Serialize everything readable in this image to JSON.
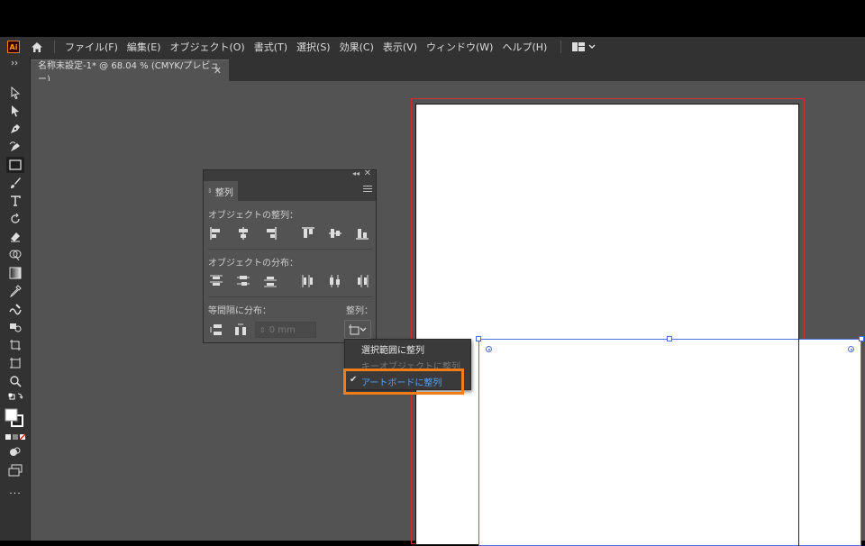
{
  "app": {
    "logo": "Ai",
    "home_icon": "home-icon"
  },
  "menu": {
    "items": [
      "ファイル(F)",
      "編集(E)",
      "オブジェクト(O)",
      "書式(T)",
      "選択(S)",
      "効果(C)",
      "表示(V)",
      "ウィンドウ(W)",
      "ヘルプ(H)"
    ],
    "workspace_icon": "workspace-switcher-icon"
  },
  "document_tab": {
    "title": "名称未設定-1* @ 68.04 % (CMYK/プレビュー)",
    "close": "✕"
  },
  "toolbar": {
    "tools": [
      "selection-tool",
      "direct-selection-tool",
      "pen-tool",
      "curvature-tool",
      "rectangle-tool",
      "paintbrush-tool",
      "type-tool",
      "rotate-tool",
      "eraser-tool",
      "shape-builder-tool",
      "gradient-tool",
      "eyedropper-tool",
      "warp-tool",
      "live-paint-tool",
      "crop-tool",
      "artboard-tool",
      "zoom-tool"
    ],
    "more": "..."
  },
  "align_panel": {
    "tab_label": "整列",
    "align_objects_label": "オブジェクトの整列：",
    "distribute_objects_label": "オブジェクトの分布：",
    "distribute_spacing_label": "等間隔に分布：",
    "align_to_label": "整列：",
    "spacing_value": "0 mm"
  },
  "align_to_menu": {
    "items": [
      {
        "label": "選択範囲に整列",
        "state": "enabled"
      },
      {
        "label": "キーオブジェクトに整列",
        "state": "disabled"
      },
      {
        "label": "アートボードに整列",
        "state": "checked"
      }
    ]
  },
  "colors": {
    "accent_highlight": "#f07d1a",
    "selection": "#4a6de0",
    "bleed": "#d42b2b",
    "checked_item": "#4ea2ff"
  }
}
